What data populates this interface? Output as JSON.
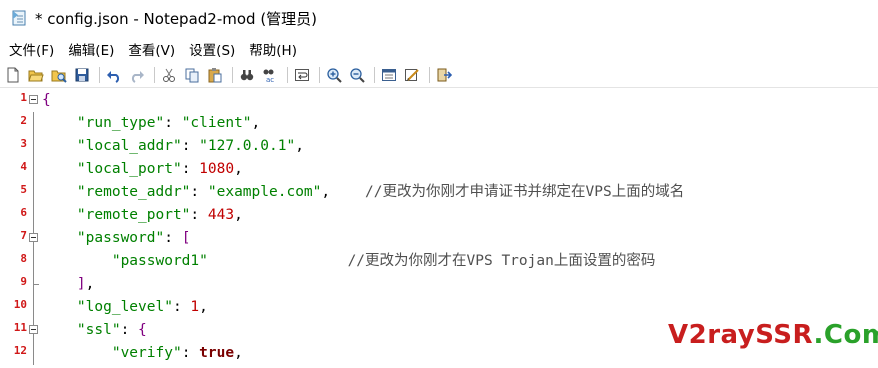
{
  "window": {
    "title": "* config.json - Notepad2-mod (管理员)"
  },
  "menu": [
    {
      "label": "文件(F)"
    },
    {
      "label": "编辑(E)"
    },
    {
      "label": "查看(V)"
    },
    {
      "label": "设置(S)"
    },
    {
      "label": "帮助(H)"
    }
  ],
  "toolbar": {
    "groups": [
      [
        "new-file-icon",
        "open-folder-icon",
        "browse-icon",
        "save-icon"
      ],
      [
        "undo-icon",
        "redo-icon"
      ],
      [
        "cut-icon",
        "copy-icon",
        "paste-icon"
      ],
      [
        "find-icon",
        "replace-icon"
      ],
      [
        "word-wrap-icon"
      ],
      [
        "zoom-in-icon",
        "zoom-out-icon"
      ],
      [
        "scheme-icon",
        "customize-scheme-icon"
      ],
      [
        "exit-icon"
      ]
    ]
  },
  "editor": {
    "lines": [
      {
        "num": "1",
        "fold": "open",
        "tokens": [
          {
            "c": "bracket",
            "t": "{"
          }
        ]
      },
      {
        "num": "2",
        "fold": "line",
        "tokens": [
          {
            "c": "punc",
            "t": "    "
          },
          {
            "c": "key",
            "t": "\"run_type\""
          },
          {
            "c": "punc",
            "t": ": "
          },
          {
            "c": "str",
            "t": "\"client\""
          },
          {
            "c": "punc",
            "t": ","
          }
        ]
      },
      {
        "num": "3",
        "fold": "line",
        "tokens": [
          {
            "c": "punc",
            "t": "    "
          },
          {
            "c": "key",
            "t": "\"local_addr\""
          },
          {
            "c": "punc",
            "t": ": "
          },
          {
            "c": "str",
            "t": "\"127.0.0.1\""
          },
          {
            "c": "punc",
            "t": ","
          }
        ]
      },
      {
        "num": "4",
        "fold": "line",
        "tokens": [
          {
            "c": "punc",
            "t": "    "
          },
          {
            "c": "key",
            "t": "\"local_port\""
          },
          {
            "c": "punc",
            "t": ": "
          },
          {
            "c": "num",
            "t": "1080"
          },
          {
            "c": "punc",
            "t": ","
          }
        ]
      },
      {
        "num": "5",
        "fold": "line",
        "tokens": [
          {
            "c": "punc",
            "t": "    "
          },
          {
            "c": "key",
            "t": "\"remote_addr\""
          },
          {
            "c": "punc",
            "t": ": "
          },
          {
            "c": "str",
            "t": "\"example.com\""
          },
          {
            "c": "punc",
            "t": ",    "
          },
          {
            "c": "cmt",
            "t": "//更改为你刚才申请证书并绑定在VPS上面的域名"
          }
        ]
      },
      {
        "num": "6",
        "fold": "line",
        "tokens": [
          {
            "c": "punc",
            "t": "    "
          },
          {
            "c": "key",
            "t": "\"remote_port\""
          },
          {
            "c": "punc",
            "t": ": "
          },
          {
            "c": "num",
            "t": "443"
          },
          {
            "c": "punc",
            "t": ","
          }
        ]
      },
      {
        "num": "7",
        "fold": "open",
        "tokens": [
          {
            "c": "punc",
            "t": "    "
          },
          {
            "c": "key",
            "t": "\"password\""
          },
          {
            "c": "punc",
            "t": ": "
          },
          {
            "c": "bracket",
            "t": "["
          }
        ]
      },
      {
        "num": "8",
        "fold": "line",
        "tokens": [
          {
            "c": "punc",
            "t": "        "
          },
          {
            "c": "str",
            "t": "\"password1\""
          },
          {
            "c": "punc",
            "t": "                "
          },
          {
            "c": "cmt",
            "t": "//更改为你刚才在VPS Trojan上面设置的密码"
          }
        ]
      },
      {
        "num": "9",
        "fold": "end",
        "tokens": [
          {
            "c": "punc",
            "t": "    "
          },
          {
            "c": "bracket",
            "t": "]"
          },
          {
            "c": "punc",
            "t": ","
          }
        ]
      },
      {
        "num": "10",
        "fold": "line",
        "tokens": [
          {
            "c": "punc",
            "t": "    "
          },
          {
            "c": "key",
            "t": "\"log_level\""
          },
          {
            "c": "punc",
            "t": ": "
          },
          {
            "c": "num",
            "t": "1"
          },
          {
            "c": "punc",
            "t": ","
          }
        ]
      },
      {
        "num": "11",
        "fold": "open",
        "tokens": [
          {
            "c": "punc",
            "t": "    "
          },
          {
            "c": "key",
            "t": "\"ssl\""
          },
          {
            "c": "punc",
            "t": ": "
          },
          {
            "c": "bracket",
            "t": "{"
          }
        ]
      },
      {
        "num": "12",
        "fold": "line",
        "tokens": [
          {
            "c": "punc",
            "t": "        "
          },
          {
            "c": "key",
            "t": "\"verify\""
          },
          {
            "c": "punc",
            "t": ": "
          },
          {
            "c": "kw",
            "t": "true"
          },
          {
            "c": "punc",
            "t": ","
          }
        ]
      }
    ]
  },
  "watermark": {
    "part1": "V2raySSR",
    "part2": ".Com"
  }
}
